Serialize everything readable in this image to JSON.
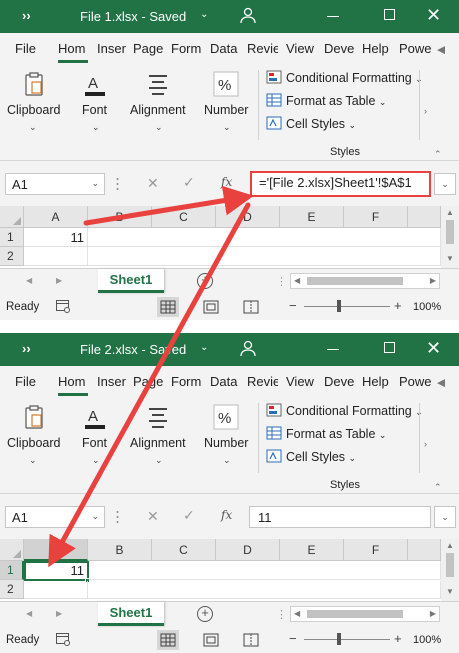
{
  "windows": [
    {
      "title": "File 1.xlsx - Saved",
      "tabs": [
        "File",
        "Hom",
        "Inser",
        "Page",
        "Form",
        "Data",
        "Revie",
        "View",
        "Deve",
        "Help",
        "Powe"
      ],
      "ribbon": {
        "clipboard": "Clipboard",
        "font": "Font",
        "alignment": "Alignment",
        "number": "Number",
        "conditional_formatting": "Conditional Formatting",
        "format_as_table": "Format as Table",
        "cell_styles": "Cell Styles",
        "styles_group": "Styles"
      },
      "name_box": "A1",
      "formula": "='[File 2.xlsx]Sheet1'!$A$1",
      "columns": [
        "A",
        "B",
        "C",
        "D",
        "E",
        "F"
      ],
      "rows": [
        "1",
        "2"
      ],
      "cell_a1": "11",
      "sheet_tab": "Sheet1",
      "status": "Ready",
      "zoom": "100%"
    },
    {
      "title": "File 2.xlsx - Saved",
      "tabs": [
        "File",
        "Hom",
        "Inser",
        "Page",
        "Form",
        "Data",
        "Revie",
        "View",
        "Deve",
        "Help",
        "Powe"
      ],
      "ribbon": {
        "clipboard": "Clipboard",
        "font": "Font",
        "alignment": "Alignment",
        "number": "Number",
        "conditional_formatting": "Conditional Formatting",
        "format_as_table": "Format as Table",
        "cell_styles": "Cell Styles",
        "styles_group": "Styles"
      },
      "name_box": "A1",
      "formula": "11",
      "columns": [
        "A",
        "B",
        "C",
        "D",
        "E",
        "F"
      ],
      "rows": [
        "1",
        "2"
      ],
      "cell_a1": "11",
      "sheet_tab": "Sheet1",
      "status": "Ready",
      "zoom": "100%"
    }
  ],
  "colors": {
    "excel_green": "#217346",
    "arrow_red": "#e8413e"
  }
}
